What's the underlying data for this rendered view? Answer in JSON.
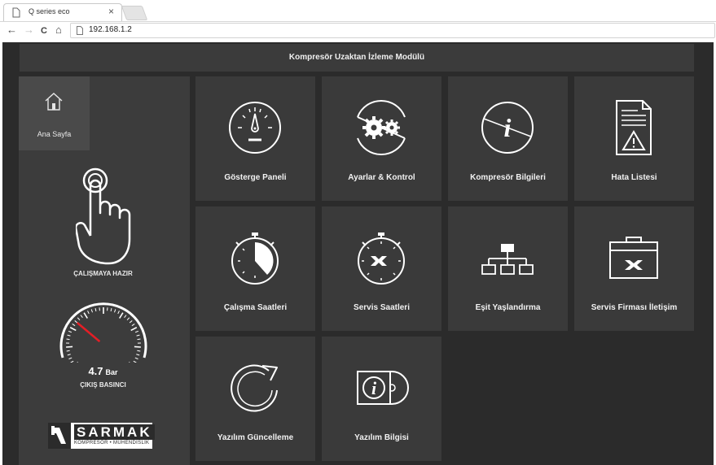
{
  "browser": {
    "tab_title": "Q series eco",
    "tab_close": "×",
    "url": "192.168.1.2",
    "nav": {
      "back": "←",
      "forward": "→",
      "reload": "C",
      "home": "⌂"
    }
  },
  "header": {
    "title": "Kompresör Uzaktan İzleme Modülü"
  },
  "sidebar": {
    "home_label": "Ana Sayfa",
    "status_label": "ÇALIŞMAYA HAZIR",
    "pressure_value": "4.7",
    "pressure_unit": "Bar",
    "pressure_label": "ÇIKIŞ BASINCI",
    "logo_name": "SARMAK",
    "logo_tagline": "KOMPRESÖR • MÜHENDİSLİK"
  },
  "tiles": [
    {
      "label": "Gösterge Paneli",
      "icon": "dashboard-gauge-icon"
    },
    {
      "label": "Ayarlar & Kontrol",
      "icon": "gears-icon"
    },
    {
      "label": "Kompresör Bilgileri",
      "icon": "info-icon"
    },
    {
      "label": "Hata Listesi",
      "icon": "error-document-icon"
    },
    {
      "label": "Çalışma Saatleri",
      "icon": "stopwatch-icon"
    },
    {
      "label": "Servis Saatleri",
      "icon": "service-stopwatch-icon"
    },
    {
      "label": "Eşit Yaşlandırma",
      "icon": "hierarchy-icon"
    },
    {
      "label": "Servis Firması İletişim",
      "icon": "toolbox-icon"
    },
    {
      "label": "Yazılım Güncelleme",
      "icon": "refresh-icon"
    },
    {
      "label": "Yazılım Bilgisi",
      "icon": "software-disc-icon"
    }
  ],
  "colors": {
    "page_bg": "#2b2b2b",
    "tile_bg": "#3a3a3a",
    "sidebar_bg": "#3c3c3c",
    "home_bg": "#4a4a4a",
    "gauge_needle": "#e41e26",
    "text": "#f2f2f2"
  },
  "gauge": {
    "needle_fraction": 0.3
  }
}
